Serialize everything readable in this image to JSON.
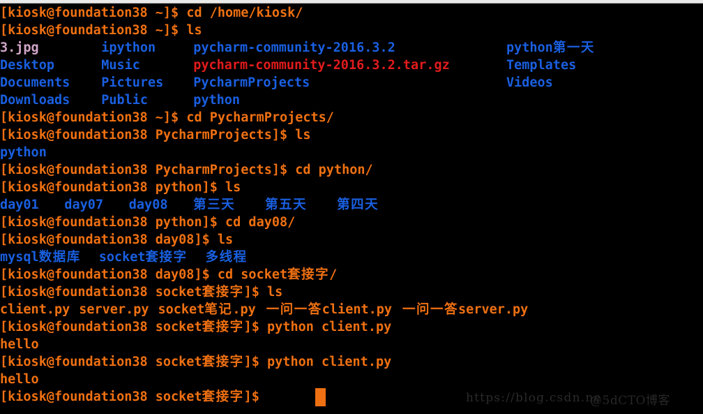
{
  "window": {
    "title_bar_color": "#e9e9e9",
    "background": "#000000"
  },
  "theme": {
    "prompt_color": "#ef7012",
    "directory_color": "#1a5fe0",
    "archive_color": "#e11b1b",
    "image_color": "#d0a5c8",
    "cursor_color": "#ef7012"
  },
  "terminal": {
    "user": "kiosk",
    "host": "foundation38",
    "lines": [
      {
        "id": "l01",
        "type": "prompt",
        "cwd": "~",
        "command": "cd /home/kiosk/"
      },
      {
        "id": "l02",
        "type": "prompt",
        "cwd": "~",
        "command": "ls"
      },
      {
        "id": "l03",
        "type": "output",
        "text": "3.jpg      ipython    pycharm-community-2016.3.2          python第一天"
      },
      {
        "id": "l04",
        "type": "output",
        "text": "Desktop    Music      pycharm-community-2016.3.2.tar.gz   Templates"
      },
      {
        "id": "l05",
        "type": "output",
        "text": "Documents  Pictures   PycharmProjects                     Videos"
      },
      {
        "id": "l06",
        "type": "output",
        "text": "Downloads  Public     python"
      },
      {
        "id": "l07",
        "type": "prompt",
        "cwd": "~",
        "command": "cd PycharmProjects/"
      },
      {
        "id": "l08",
        "type": "prompt",
        "cwd": "PycharmProjects",
        "command": "ls"
      },
      {
        "id": "l09",
        "type": "output",
        "text": "python"
      },
      {
        "id": "l10",
        "type": "prompt",
        "cwd": "PycharmProjects",
        "command": "cd python/"
      },
      {
        "id": "l11",
        "type": "prompt",
        "cwd": "python",
        "command": "ls"
      },
      {
        "id": "l12",
        "type": "output",
        "text": "day01  day07  day08  第三天  第五天  第四天"
      },
      {
        "id": "l13",
        "type": "prompt",
        "cwd": "python",
        "command": "cd day08/"
      },
      {
        "id": "l14",
        "type": "prompt",
        "cwd": "day08",
        "command": "ls"
      },
      {
        "id": "l15",
        "type": "output",
        "text": "mysql数据库  socket套接字  多线程"
      },
      {
        "id": "l16",
        "type": "prompt",
        "cwd": "day08",
        "command": "cd socket套接字/"
      },
      {
        "id": "l17",
        "type": "prompt",
        "cwd": "socket套接字",
        "command": "ls"
      },
      {
        "id": "l18",
        "type": "output",
        "text": "client.py  server.py  socket笔记.py  一问一答client.py  一问一答server.py"
      },
      {
        "id": "l19",
        "type": "prompt",
        "cwd": "socket套接字",
        "command": "python client.py"
      },
      {
        "id": "l20",
        "type": "output",
        "text": "hello"
      },
      {
        "id": "l21",
        "type": "prompt",
        "cwd": "socket套接字",
        "command": "python client.py"
      },
      {
        "id": "l22",
        "type": "output",
        "text": "hello"
      },
      {
        "id": "l23",
        "type": "prompt",
        "cwd": "socket套接字",
        "command": ""
      }
    ],
    "prompt_bracket_open": "[",
    "prompt_at": "@",
    "prompt_bracket_close": "]$",
    "prompt_space": " "
  },
  "ls_home": {
    "col1": [
      "3.jpg",
      "Desktop",
      "Documents",
      "Downloads"
    ],
    "col2": [
      "ipython",
      "Music",
      "Pictures",
      "Public"
    ],
    "col3": [
      "pycharm-community-2016.3.2",
      "pycharm-community-2016.3.2.tar.gz",
      "PycharmProjects",
      "python"
    ],
    "col4": [
      "python第一天",
      "Templates",
      "Videos"
    ],
    "types": {
      "3.jpg": "image",
      "Desktop": "dir",
      "Documents": "dir",
      "Downloads": "dir",
      "ipython": "dir",
      "Music": "dir",
      "Pictures": "dir",
      "Public": "dir",
      "pycharm-community-2016.3.2": "dir",
      "pycharm-community-2016.3.2.tar.gz": "archive",
      "PycharmProjects": "dir",
      "python": "dir",
      "python第一天": "dir",
      "Templates": "dir",
      "Videos": "dir"
    }
  },
  "ls_python": [
    "day01",
    "day07",
    "day08",
    "第三天",
    "第五天",
    "第四天"
  ],
  "ls_day08": [
    "mysql数据库",
    "socket套接字",
    "多线程"
  ],
  "ls_socket": [
    "client.py",
    "server.py",
    "socket笔记.py",
    "一问一答client.py",
    "一问一答server.py"
  ],
  "cursor": {
    "visible": true,
    "shape": "block"
  },
  "watermark": {
    "url": "https://blog.csdn.ne",
    "handle": "@5dCTO博客",
    "overlay": "t/aaaaaa"
  },
  "text": {
    "l01_cmd": "cd /home/kiosk/",
    "l02_cmd": "ls",
    "l07_cmd": "cd PycharmProjects/",
    "l08_cmd": "ls",
    "l09_out": "python",
    "l10_cmd": "cd python/",
    "l11_cmd": "ls",
    "l13_cmd": "cd day08/",
    "l14_cmd": "ls",
    "l16_cmd": "cd socket套接字/",
    "l17_cmd": "ls",
    "l18_f1": "client.py",
    "l18_f2": "server.py",
    "l18_f3": "socket笔记.py",
    "l18_f4": "一问一答client.py",
    "l18_f5": "一问一答server.py",
    "l19_cmd": "python client.py",
    "l20_out": "hello",
    "l21_cmd": "python client.py",
    "l22_out": "hello",
    "prompt_home": "[kiosk@foundation38 ~]$ ",
    "prompt_pycharm": "[kiosk@foundation38 PycharmProjects]$ ",
    "prompt_python": "[kiosk@foundation38 python]$ ",
    "prompt_day08": "[kiosk@foundation38 day08]$ ",
    "prompt_socket_pre": "[kiosk@foundation38 socket",
    "prompt_socket_cjk": "套接字",
    "prompt_socket_post": "]$ ",
    "col1_r1": "3.jpg",
    "col1_r2": "Desktop",
    "col1_r3": "Documents",
    "col1_r4": "Downloads",
    "col2_r1": "ipython",
    "col2_r2": "Music",
    "col2_r3": "Pictures",
    "col2_r4": "Public",
    "col3_r1": "pycharm-community-2016.3.2",
    "col3_r2": "pycharm-community-2016.3.2.tar.gz",
    "col3_r3": "PycharmProjects",
    "col3_r4": "python",
    "col4_r1_en": "python",
    "col4_r1_cjk": "第一天",
    "col4_r2": "Templates",
    "col4_r3": "Videos",
    "py_d1": "day01",
    "py_d2": "day07",
    "py_d3": "day08",
    "py_c1": "第三天",
    "py_c2": "第五天",
    "py_c3": "第四天",
    "d08_1": "mysql",
    "d08_1c": "数据库",
    "d08_2": "socket",
    "d08_2c": "套接字",
    "d08_3c": "多线程"
  }
}
